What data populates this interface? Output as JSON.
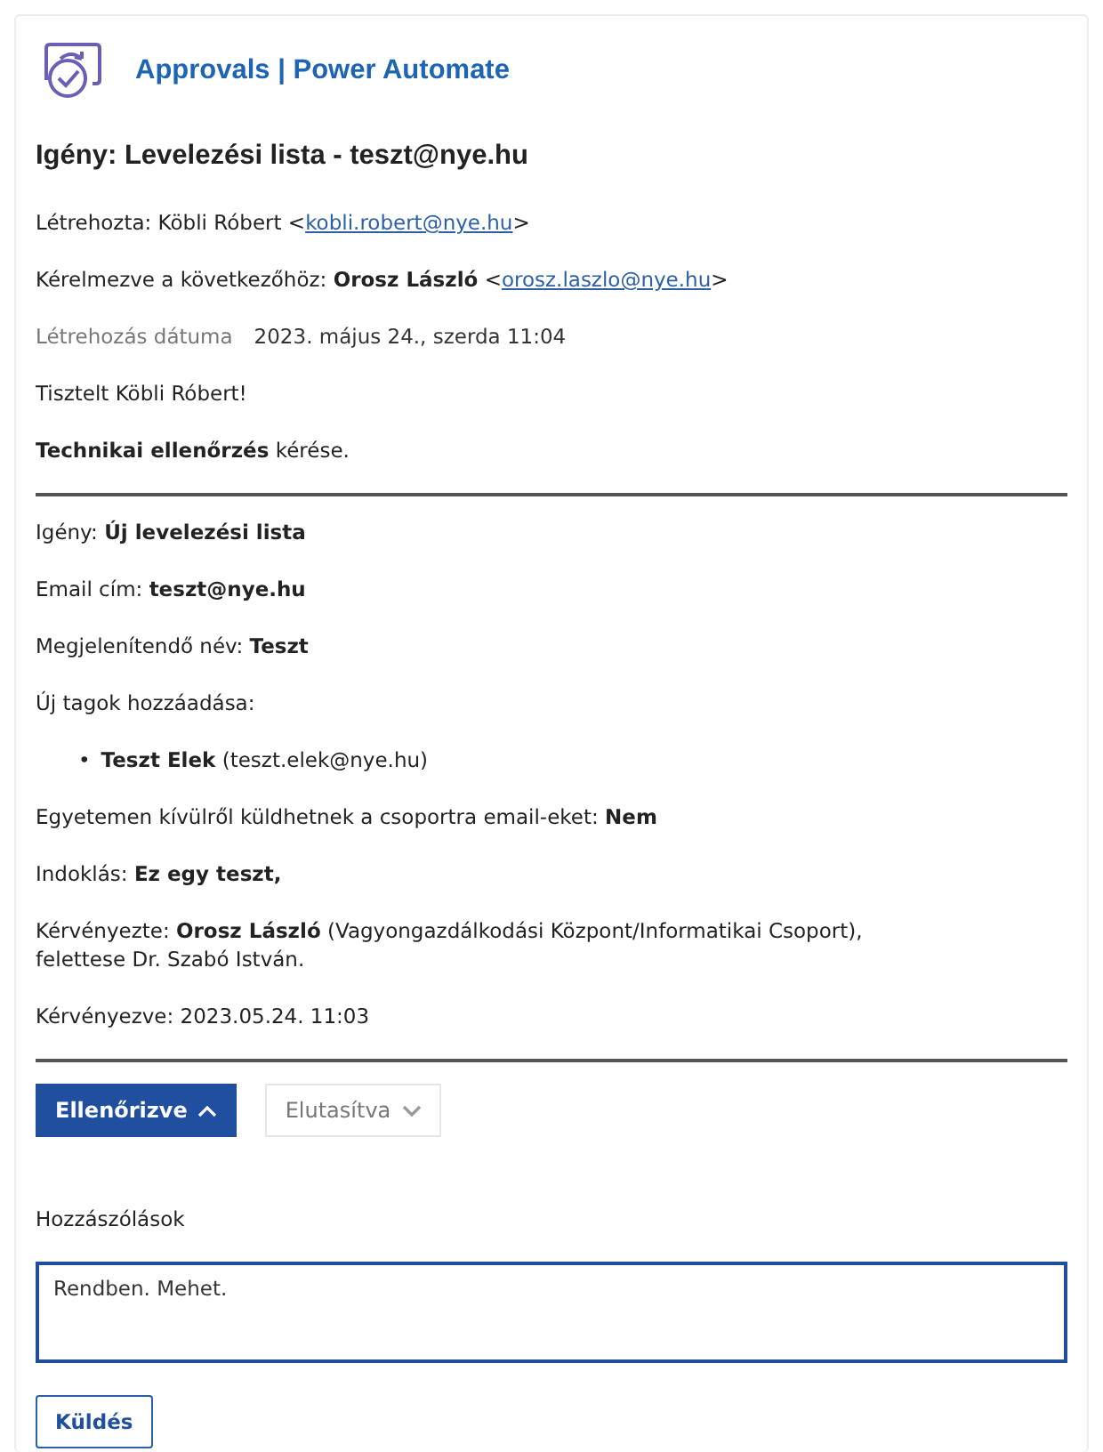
{
  "header": {
    "title": "Approvals | Power Automate"
  },
  "subject": "Igény: Levelezési lista - teszt@nye.hu",
  "meta": [
    {
      "kind": "line",
      "parts": [
        {
          "kind": "text",
          "text": "Létrehozta: Köbli Róbert <"
        },
        {
          "kind": "link",
          "text": "kobli.robert@nye.hu"
        },
        {
          "kind": "text",
          "text": ">"
        }
      ]
    },
    {
      "kind": "line",
      "parts": [
        {
          "kind": "text",
          "text": "Kérelmezve a következőhöz: **Orosz László** <"
        },
        {
          "kind": "link",
          "text": "orosz.laszlo@nye.hu"
        },
        {
          "kind": "text",
          "text": ">"
        }
      ]
    },
    {
      "kind": "date",
      "label": "Létrehozás dátuma",
      "value": "2023. május 24., szerda 11:04"
    },
    {
      "kind": "para",
      "text": "Tisztelt Köbli Róbert!"
    },
    {
      "kind": "para",
      "text": "**Technikai ellenőrzés** kérése."
    }
  ],
  "details": [
    {
      "kind": "para",
      "text": "Igény: **Új levelezési lista**"
    },
    {
      "kind": "para",
      "text": "Email cím: **teszt@nye.hu**"
    },
    {
      "kind": "para",
      "text": "Megjelenítendő név: **Teszt**"
    },
    {
      "kind": "para",
      "text": "Új tagok hozzáadása:"
    },
    {
      "kind": "bullets",
      "items": [
        {
          "marker": "•",
          "text": "**Teszt Elek** (teszt.elek@nye.hu)"
        }
      ]
    },
    {
      "kind": "para",
      "text": "Egyetemen kívülről küldhetnek a csoportra email-eket: **Nem**"
    },
    {
      "kind": "para",
      "text": "Indoklás: **Ez egy teszt,**"
    },
    {
      "kind": "para",
      "text": "Kérvényezte: **Orosz László** (Vagyongazdálkodási Központ/Informatikai Csoport),\nfelettese Dr. Szabó István."
    },
    {
      "kind": "para",
      "text": "Kérvényezve: 2023.05.24. 11:03"
    }
  ],
  "actions": [
    {
      "label": "Ellenőrizve",
      "selected": true
    },
    {
      "label": "Elutasítva",
      "selected": false
    }
  ],
  "comments": {
    "label": "Hozzászólások",
    "value": "Rendben. Mehet."
  },
  "send_button": "Küldés"
}
